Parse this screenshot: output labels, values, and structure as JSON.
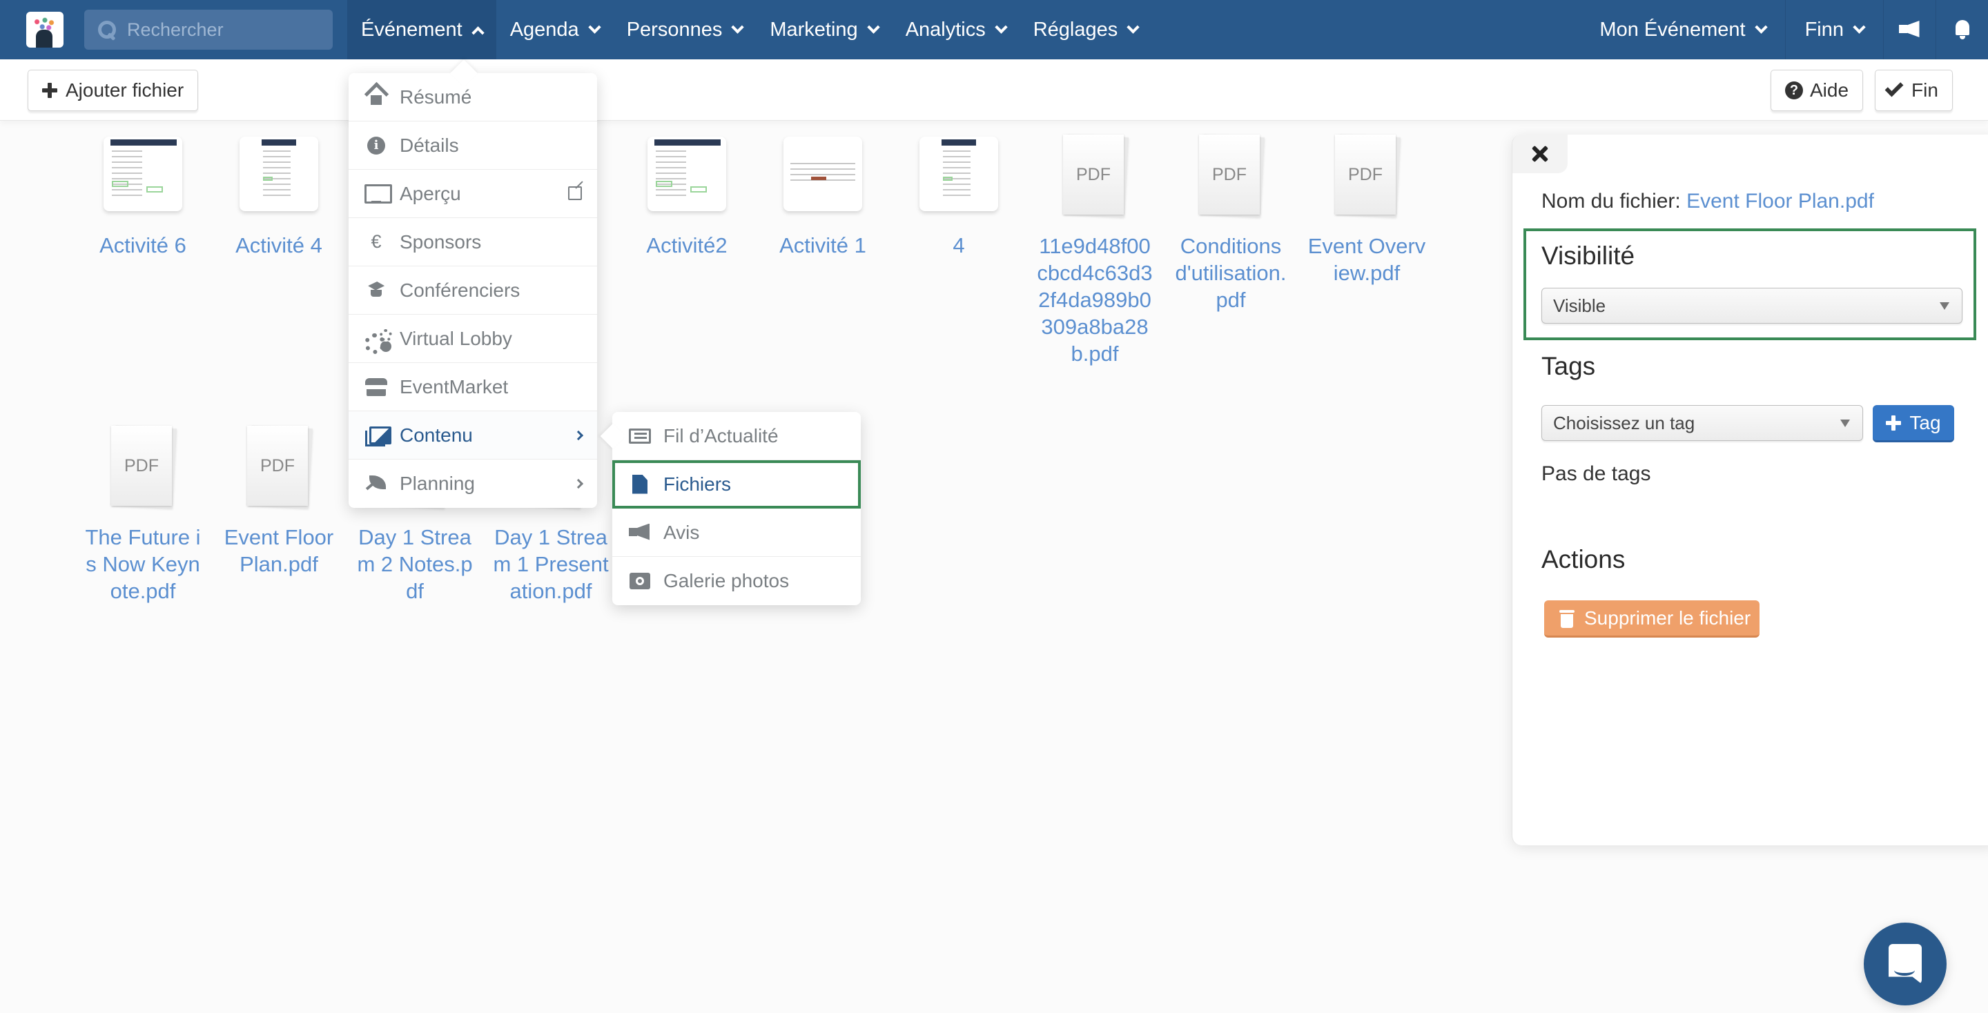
{
  "topnav": {
    "search_placeholder": "Rechercher",
    "menu": [
      {
        "label": "Événement",
        "open": true
      },
      {
        "label": "Agenda"
      },
      {
        "label": "Personnes"
      },
      {
        "label": "Marketing"
      },
      {
        "label": "Analytics"
      },
      {
        "label": "Réglages"
      }
    ],
    "event_selector": "Mon Événement",
    "user": "Finn",
    "icons": [
      "megaphone-icon",
      "bell-icon"
    ]
  },
  "toolbar": {
    "add_file_label": "Ajouter fichier",
    "help_label": "Aide",
    "done_label": "Fin"
  },
  "event_menu": {
    "items": [
      {
        "label": "Résumé",
        "icon": "house-icon"
      },
      {
        "label": "Détails",
        "icon": "info-icon"
      },
      {
        "label": "Aperçu",
        "icon": "monitor-icon",
        "external": true
      },
      {
        "label": "Sponsors",
        "icon": "euro-icon",
        "glyph": "€"
      },
      {
        "label": "Conférenciers",
        "icon": "graduation-cap-icon"
      },
      {
        "label": "Virtual Lobby",
        "icon": "gears-icon"
      },
      {
        "label": "EventMarket",
        "icon": "store-icon"
      },
      {
        "label": "Contenu",
        "icon": "images-icon",
        "submenu": true,
        "active": true
      },
      {
        "label": "Planning",
        "icon": "leaf-icon",
        "submenu": true
      }
    ]
  },
  "content_submenu": {
    "items": [
      {
        "label": "Fil d’Actualité",
        "icon": "newspaper-icon"
      },
      {
        "label": "Fichiers",
        "icon": "file-icon",
        "highlighted": true
      },
      {
        "label": "Avis",
        "icon": "megaphone-icon"
      },
      {
        "label": "Galerie photos",
        "icon": "camera-icon"
      }
    ]
  },
  "files": {
    "pdf_label": "PDF",
    "row1": [
      {
        "name": "Activité 6",
        "type": "image"
      },
      {
        "name": "Activité 4",
        "type": "image"
      },
      {
        "name": "Activité2",
        "type": "image"
      },
      {
        "name": "Activité 1",
        "type": "image"
      },
      {
        "name": "4",
        "type": "image"
      },
      {
        "name": "11e9d48f00cbcd4c63d32f4da989b0309a8ba28b.pdf",
        "type": "pdf"
      },
      {
        "name": "Conditions d'utilisation.pdf",
        "type": "pdf"
      },
      {
        "name": "Event Overview.pdf",
        "type": "pdf"
      }
    ],
    "row2": [
      {
        "name": "The Future is Now Keynote.pdf",
        "type": "pdf"
      },
      {
        "name": "Event Floor Plan.pdf",
        "type": "pdf"
      },
      {
        "name": "Day 1 Stream 2 Notes.pdf",
        "type": "pdf"
      },
      {
        "name": "Day 1 Stream 1 Presentation.pdf",
        "type": "pdf"
      }
    ]
  },
  "panel": {
    "filename_label": "Nom du fichier:",
    "filename": "Event Floor Plan.pdf",
    "visibility_heading": "Visibilité",
    "visibility_value": "Visible",
    "tags_heading": "Tags",
    "tag_placeholder": "Choisissez un tag",
    "add_tag_label": "Tag",
    "no_tags_text": "Pas de tags",
    "actions_heading": "Actions",
    "delete_label": "Supprimer le fichier"
  },
  "colors": {
    "nav_blue": "#29598b",
    "link_blue": "#5b8fd0",
    "highlight_green": "#3a8a56",
    "primary_button": "#3577c6",
    "warning_button": "#efa06a"
  }
}
